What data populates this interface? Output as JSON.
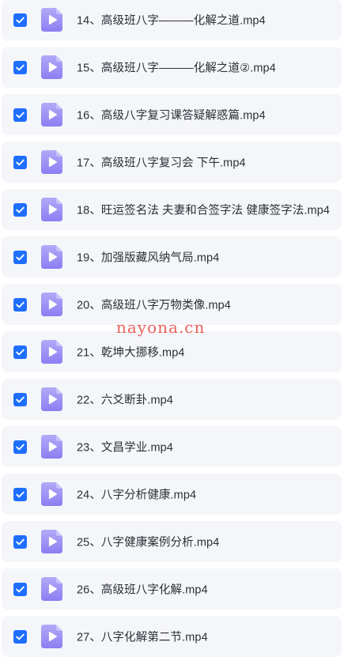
{
  "files": [
    {
      "name": "14、高级班八字———化解之道.mp4",
      "checked": true
    },
    {
      "name": "15、高级班八字———化解之道②.mp4",
      "checked": true
    },
    {
      "name": "16、高级八字复习课答疑解惑篇.mp4",
      "checked": true
    },
    {
      "name": "17、高级班八字复习会 下午.mp4",
      "checked": true
    },
    {
      "name": "18、旺运签名法 夫妻和合签字法 健康签字法.mp4",
      "checked": true
    },
    {
      "name": "19、加强版藏风纳气局.mp4",
      "checked": true
    },
    {
      "name": "20、高级班八字万物类像.mp4",
      "checked": true
    },
    {
      "name": "21、乾坤大挪移.mp4",
      "checked": true
    },
    {
      "name": "22、六爻断卦.mp4",
      "checked": true
    },
    {
      "name": "23、文昌学业.mp4",
      "checked": true
    },
    {
      "name": "24、八字分析健康.mp4",
      "checked": true
    },
    {
      "name": "25、八字健康案例分析.mp4",
      "checked": true
    },
    {
      "name": "26、高级班八字化解.mp4",
      "checked": true
    },
    {
      "name": "27、八字化解第二节.mp4",
      "checked": true
    }
  ],
  "icons": {
    "checkbox": "checkbox-checked-icon",
    "file": "video-play-icon"
  },
  "colors": {
    "checkbox": "#1e6fff",
    "icon_top": "#b4aaf8",
    "icon_bottom": "#8b7ef3",
    "row_bg": "#f5f6f9",
    "text": "#2b2f36",
    "watermark": "#e7544e"
  },
  "watermark": "nayona.cn"
}
